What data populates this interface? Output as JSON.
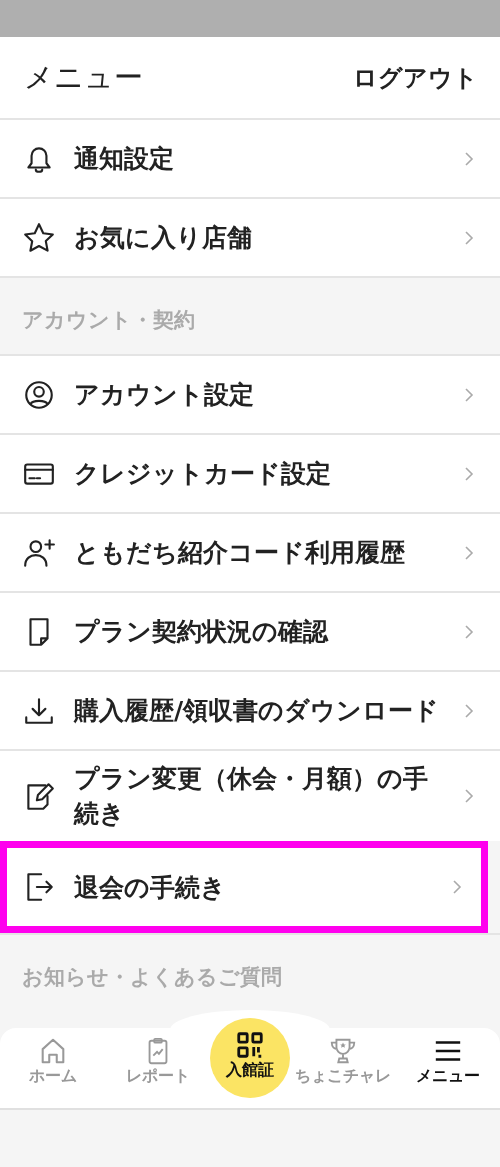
{
  "header": {
    "title": "メニュー",
    "logout": "ログアウト"
  },
  "groups": [
    {
      "items": [
        {
          "label": "通知設定",
          "selected": false
        },
        {
          "label": "お気に入り店舗",
          "selected": false
        }
      ]
    },
    {
      "title": "アカウント・契約",
      "items": [
        {
          "label": "アカウント設定",
          "selected": false
        },
        {
          "label": "クレジットカード設定",
          "selected": false
        },
        {
          "label": "ともだち紹介コード利用履歴",
          "selected": false
        },
        {
          "label": "プラン契約状況の確認",
          "selected": false
        },
        {
          "label": "購入履歴/領収書のダウンロード",
          "selected": false
        },
        {
          "label": "プラン変更（休会・月額）の手続き",
          "selected": false
        },
        {
          "label": "退会の手続き",
          "selected": true
        }
      ]
    },
    {
      "title": "お知らせ・よくあるご質問"
    }
  ],
  "nav": [
    {
      "label": "ホーム",
      "kind": "home",
      "selected": false
    },
    {
      "label": "レポート",
      "kind": "report",
      "selected": false
    },
    {
      "label": "入館証",
      "kind": "pass",
      "selected": false
    },
    {
      "label": "ちょこチャレ",
      "kind": "trophy",
      "selected": false
    },
    {
      "label": "メニュー",
      "kind": "menu",
      "selected": true
    }
  ]
}
